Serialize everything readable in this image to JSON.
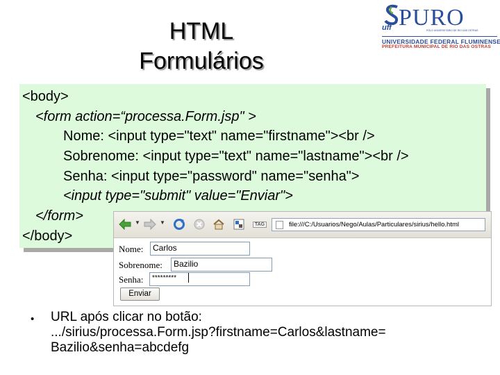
{
  "title": {
    "line1": "HTML",
    "line2": "Formulários"
  },
  "logo": {
    "name": "PURO",
    "uff": "uff",
    "sub": "PÓLO UNIVERSITÁRIO DE RIO DAS OSTRAS",
    "line1": "UNIVERSIDADE FEDERAL FLUMINENSE",
    "line2": "PREFEITURA MUNICIPAL DE RIO DAS OSTRAS",
    "colors": {
      "blue": "#2a4e9a",
      "red": "#c0392b"
    }
  },
  "code": {
    "lines": [
      "<body>",
      "<form action=“processa.Form.jsp\" >",
      "Nome: <input type=\"text\" name=\"firstname\"><br />",
      "Sobrenome: <input type=\"text\" name=\"lastname\"><br />",
      "Senha: <input type=\"password\" name=\"senha\">",
      "<input type=\"submit\" value=\"Enviar\">",
      "</form>",
      "</body>"
    ],
    "background": "#ddfadd"
  },
  "browser": {
    "url": "file:///C:/Usuarios/Nego/Aulas/Particulares/sirius/hello.html",
    "icons": [
      "back-arrow-icon",
      "forward-arrow-icon",
      "reload-icon",
      "stop-icon",
      "home-icon",
      "bookmark-icon",
      "tag-icon"
    ],
    "tag_label": "TAG",
    "form": {
      "nome_label": "Nome:",
      "nome_value": "Carlos",
      "sobrenome_label": "Sobrenome:",
      "sobrenome_value": "Bazilio",
      "senha_label": "Senha:",
      "senha_value": "*********",
      "submit_label": "Enviar"
    }
  },
  "bullet": {
    "line1": "URL após clicar no botão:",
    "line2": ".../sirius/processa.Form.jsp?firstname=Carlos&lastname=",
    "line3": "Bazilio&senha=abcdefg"
  }
}
